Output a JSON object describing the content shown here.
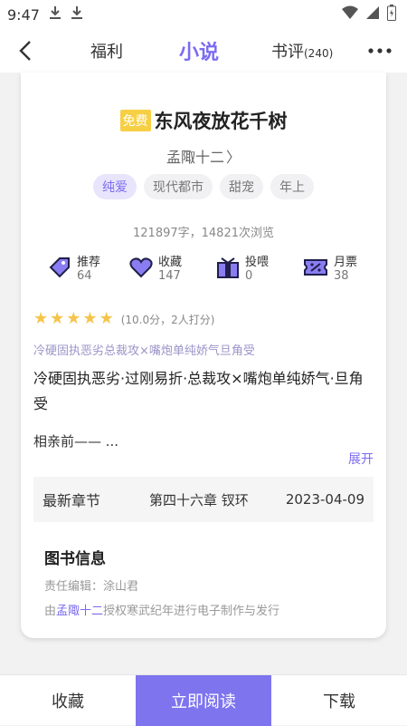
{
  "status_bar": {
    "time": "9:47"
  },
  "nav": {
    "tabs": [
      {
        "label": "福利"
      },
      {
        "label": "小说"
      },
      {
        "label": "书评",
        "count": "(240)"
      }
    ]
  },
  "book": {
    "free_badge": "免费",
    "title": "东风夜放花千树",
    "author": "孟陬十二",
    "author_arrow": "〉",
    "tags": [
      "纯爱",
      "现代都市",
      "甜宠",
      "年上"
    ],
    "stats": "121897字，14821次浏览"
  },
  "metrics": [
    {
      "label": "推荐",
      "value": "64",
      "icon": "recommend-icon"
    },
    {
      "label": "收藏",
      "value": "147",
      "icon": "heart-icon"
    },
    {
      "label": "投喂",
      "value": "0",
      "icon": "gift-icon"
    },
    {
      "label": "月票",
      "value": "38",
      "icon": "ticket-icon"
    }
  ],
  "rating": {
    "stars": 5,
    "text": "(10.0分，2人打分)",
    "color": "#f5c44a"
  },
  "intro": {
    "tagline": "冷硬固执恶劣总裁攻×嘴炮单纯娇气旦角受",
    "summary": "冷硬固执恶劣·过刚易折·总裁攻×嘴炮单纯娇气·旦角受",
    "more": "相亲前—— ...",
    "expand": "展开"
  },
  "latest": {
    "label": "最新章节",
    "chapter": "第四十六章 钗环",
    "date": "2023-04-09"
  },
  "info": {
    "title": "图书信息",
    "editor": "责任编辑：涂山君",
    "rights_prefix": "由",
    "rights_author": "孟陬十二",
    "rights_suffix": "授权寒武纪年进行电子制作与发行"
  },
  "bottom": {
    "collect": "收藏",
    "read": "立即阅读",
    "download": "下载"
  },
  "colors": {
    "accent": "#7c6cf0",
    "free_badge": "#f7cf45"
  }
}
